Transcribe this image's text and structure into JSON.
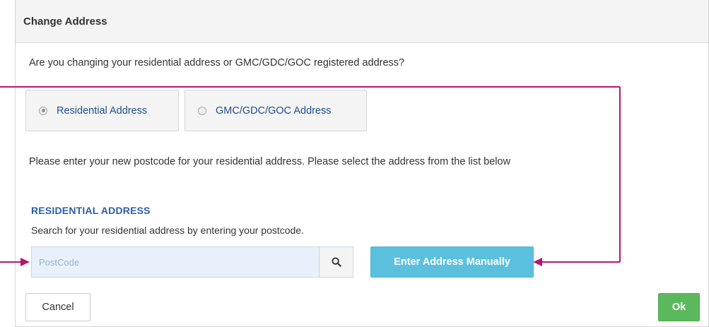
{
  "dialog": {
    "title": "Change Address",
    "question": "Are you changing your residential address or GMC/GDC/GOC registered address?"
  },
  "address_type": {
    "options": [
      {
        "label": "Residential Address",
        "selected": true
      },
      {
        "label": "GMC/GDC/GOC Address",
        "selected": false
      }
    ]
  },
  "instruction": "Please enter your new postcode for your residential address. Please select the address from the list below",
  "residential": {
    "section_title": "RESIDENTIAL ADDRESS",
    "help_text": "Search for your residential address by entering your postcode.",
    "postcode_placeholder": "PostCode",
    "postcode_value": "",
    "search_icon": "search-icon",
    "manual_button_label": "Enter Address Manually"
  },
  "footer": {
    "cancel_label": "Cancel",
    "ok_label": "Ok"
  },
  "colors": {
    "annotation": "#b5176f",
    "info_button": "#5bc0de",
    "ok_button": "#5cb85c",
    "link_text": "#1f4e8c",
    "section_title": "#2b5ea6",
    "input_bg": "#e8f1fb"
  }
}
